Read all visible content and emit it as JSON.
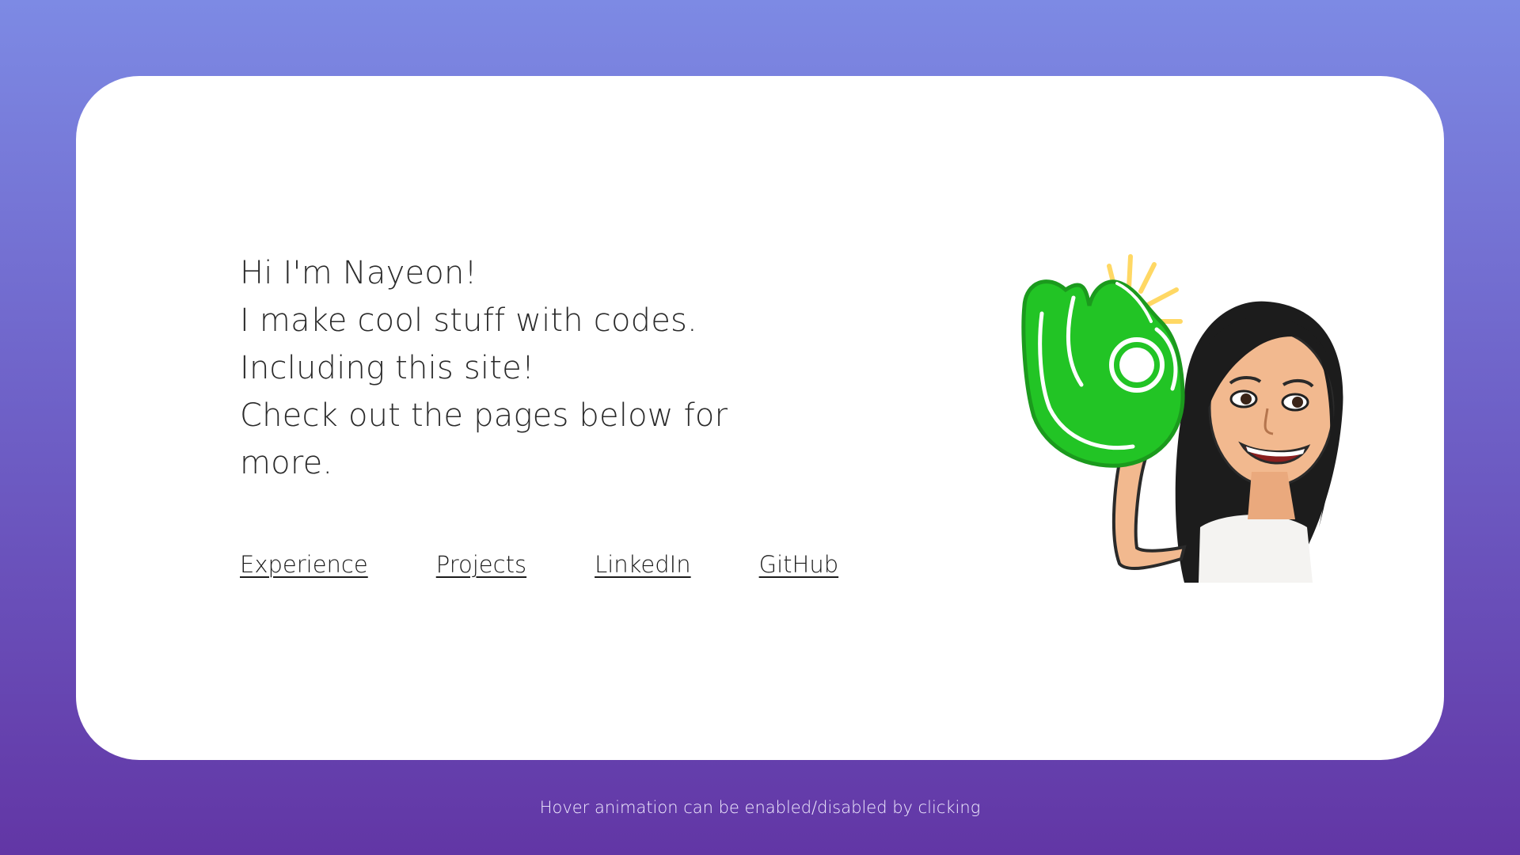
{
  "intro": {
    "line1": "Hi I'm Nayeon!",
    "line2": "I make cool stuff with codes.",
    "line3": "Including this site!",
    "line4": "Check out the pages below for",
    "line5": "more."
  },
  "nav": {
    "experience": "Experience",
    "projects": "Projects",
    "linkedin": "LinkedIn",
    "github": "GitHub"
  },
  "footer": {
    "note": "Hover animation can be enabled/disabled by clicking"
  },
  "avatar": {
    "icon": "bitmoji-ok-hand-avatar-icon"
  },
  "colors": {
    "bg_top": "#7d8ae4",
    "bg_bottom": "#6236a5",
    "card": "#ffffff",
    "text": "#2a2a2a",
    "foam_hand": "#22c425"
  }
}
